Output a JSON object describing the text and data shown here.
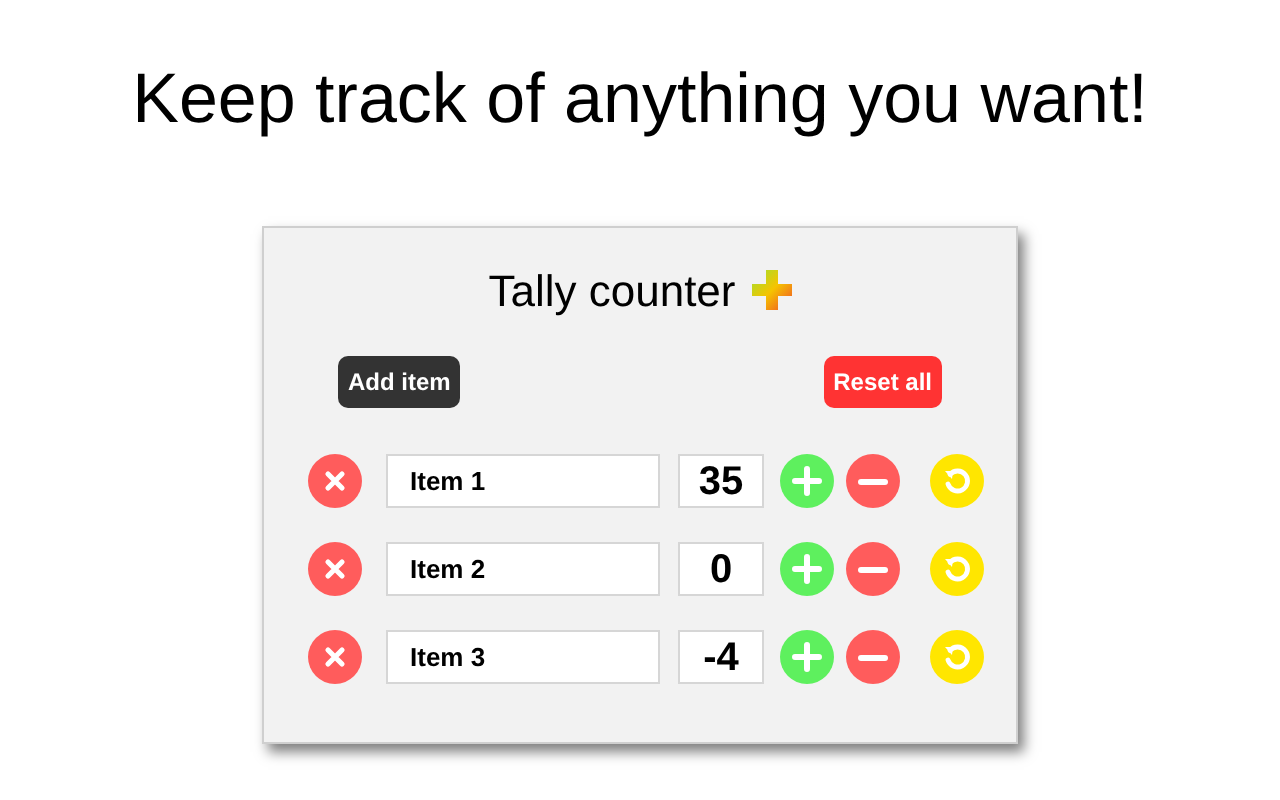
{
  "headline": "Keep track of anything you want!",
  "popup": {
    "title": "Tally counter",
    "add_button": "Add item",
    "reset_button": "Reset all",
    "items": [
      {
        "name": "Item 1",
        "count": "35"
      },
      {
        "name": "Item 2",
        "count": "0"
      },
      {
        "name": "Item 3",
        "count": "-4"
      }
    ]
  }
}
